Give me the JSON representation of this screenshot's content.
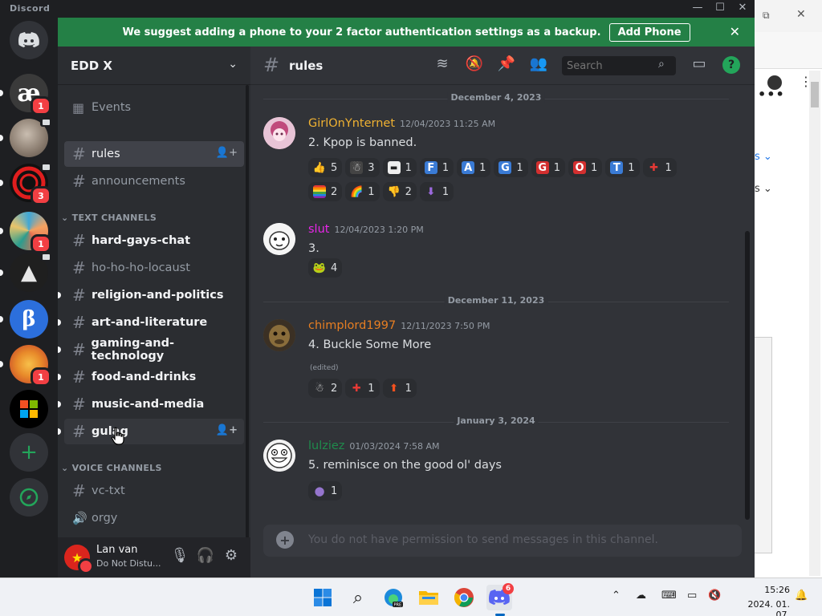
{
  "app": {
    "title": "Discord"
  },
  "banner": {
    "text": "We suggest adding a phone to your 2 factor authentication settings as a backup.",
    "button": "Add Phone"
  },
  "servers": [
    {
      "name": "ae-server",
      "glyph": "æ",
      "badge": "1",
      "bg": "#3a3a3a",
      "color": "#ffffff"
    },
    {
      "name": "cat-server",
      "glyph": "",
      "badge": "",
      "bg": "#8a8077",
      "color": "#ffffff"
    },
    {
      "name": "red-ring-server",
      "glyph": "",
      "badge": "3",
      "bg": "#111111",
      "color": "#e01e1e"
    },
    {
      "name": "colorful-server",
      "glyph": "",
      "badge": "1",
      "bg": "#d28b5a",
      "color": "#ffffff"
    },
    {
      "name": "arch-server",
      "glyph": "▲",
      "badge": "",
      "bg": "#1f1f1f",
      "color": "#e6e6e6"
    },
    {
      "name": "beta-server",
      "glyph": "β",
      "badge": "",
      "bg": "#2c6fdc",
      "color": "#ffffff"
    },
    {
      "name": "orange-server",
      "glyph": "",
      "badge": "1",
      "bg": "#e88a2a",
      "color": "#ffffff"
    },
    {
      "name": "microsoft-server",
      "glyph": "",
      "badge": "",
      "bg": "#000000",
      "color": "#ffffff"
    }
  ],
  "guild": {
    "name": "EDD X"
  },
  "sidebar": {
    "events": "Events",
    "channels_top": [
      {
        "name": "rules",
        "state": "active"
      },
      {
        "name": "announcements",
        "state": "muted"
      }
    ],
    "text_category": "TEXT CHANNELS",
    "text_channels": [
      {
        "name": "hard-gays-chat",
        "state": "unread"
      },
      {
        "name": "ho-ho-ho-locaust",
        "state": "muted"
      },
      {
        "name": "religion-and-politics",
        "state": "unread"
      },
      {
        "name": "art-and-literature",
        "state": "unread"
      },
      {
        "name": "gaming-and-technology",
        "state": "unread"
      },
      {
        "name": "food-and-drinks",
        "state": "unread"
      },
      {
        "name": "music-and-media",
        "state": "unread"
      },
      {
        "name": "gulag",
        "state": "hover"
      }
    ],
    "voice_category": "VOICE CHANNELS",
    "voice_channels": [
      {
        "name": "vc-txt",
        "type": "text"
      },
      {
        "name": "orgy",
        "type": "voice"
      }
    ]
  },
  "user": {
    "name": "Lan van",
    "status": "Do Not Distu..."
  },
  "channel": {
    "name": "rules",
    "search_placeholder": "Search"
  },
  "chat": {
    "dividers": [
      "December 4, 2023",
      "December 11, 2023",
      "January 3, 2024"
    ],
    "messages": [
      {
        "author": "GirlOnYnternet",
        "author_color": "#f0b232",
        "timestamp": "12/04/2023 11:25 AM",
        "content": "2. Kpop is banned.",
        "reactions": [
          [
            {
              "emoji": "👍",
              "count": "5"
            },
            {
              "emoji": "☃",
              "count": "3"
            },
            {
              "emoji": "▬",
              "count": "1"
            },
            {
              "emoji": "F",
              "count": "1"
            },
            {
              "emoji": "A",
              "count": "1"
            },
            {
              "emoji": "G",
              "count": "1"
            },
            {
              "emoji": "G",
              "count": "1"
            },
            {
              "emoji": "O",
              "count": "1"
            },
            {
              "emoji": "T",
              "count": "1"
            },
            {
              "emoji": "✚",
              "count": "1"
            }
          ],
          [
            {
              "emoji": "▬",
              "count": "2"
            },
            {
              "emoji": "🌈",
              "count": "1"
            },
            {
              "emoji": "👎",
              "count": "2"
            },
            {
              "emoji": "⬇",
              "count": "1"
            }
          ]
        ]
      },
      {
        "author": "slut",
        "author_color": "#e926e9",
        "timestamp": "12/04/2023 1:20 PM",
        "content": "3.",
        "reactions": [
          [
            {
              "emoji": "🐸",
              "count": "4"
            }
          ]
        ]
      },
      {
        "author": "chimplord1997",
        "author_color": "#e67e22",
        "timestamp": "12/11/2023 7:50 PM",
        "content": "4. Buckle Some More",
        "edited": "(edited)",
        "reactions": [
          [
            {
              "emoji": "☃",
              "count": "2"
            },
            {
              "emoji": "✚",
              "count": "1"
            },
            {
              "emoji": "⬆",
              "count": "1"
            }
          ]
        ]
      },
      {
        "author": "lulziez",
        "author_color": "#1f8b4c",
        "timestamp": "01/03/2024 7:58 AM",
        "content": "5. reminisce on the good ol' days",
        "reactions": [
          [
            {
              "emoji": "●",
              "count": "1"
            }
          ]
        ]
      }
    ]
  },
  "composer": {
    "placeholder": "You do not have permission to send messages in this channel."
  },
  "taskbar": {
    "time": "15:26",
    "date": "2024. 01. 07.",
    "discord_badge": "6"
  },
  "background": {
    "dots": "•••",
    "link1": "s ⌄",
    "link2": "s ⌄"
  }
}
